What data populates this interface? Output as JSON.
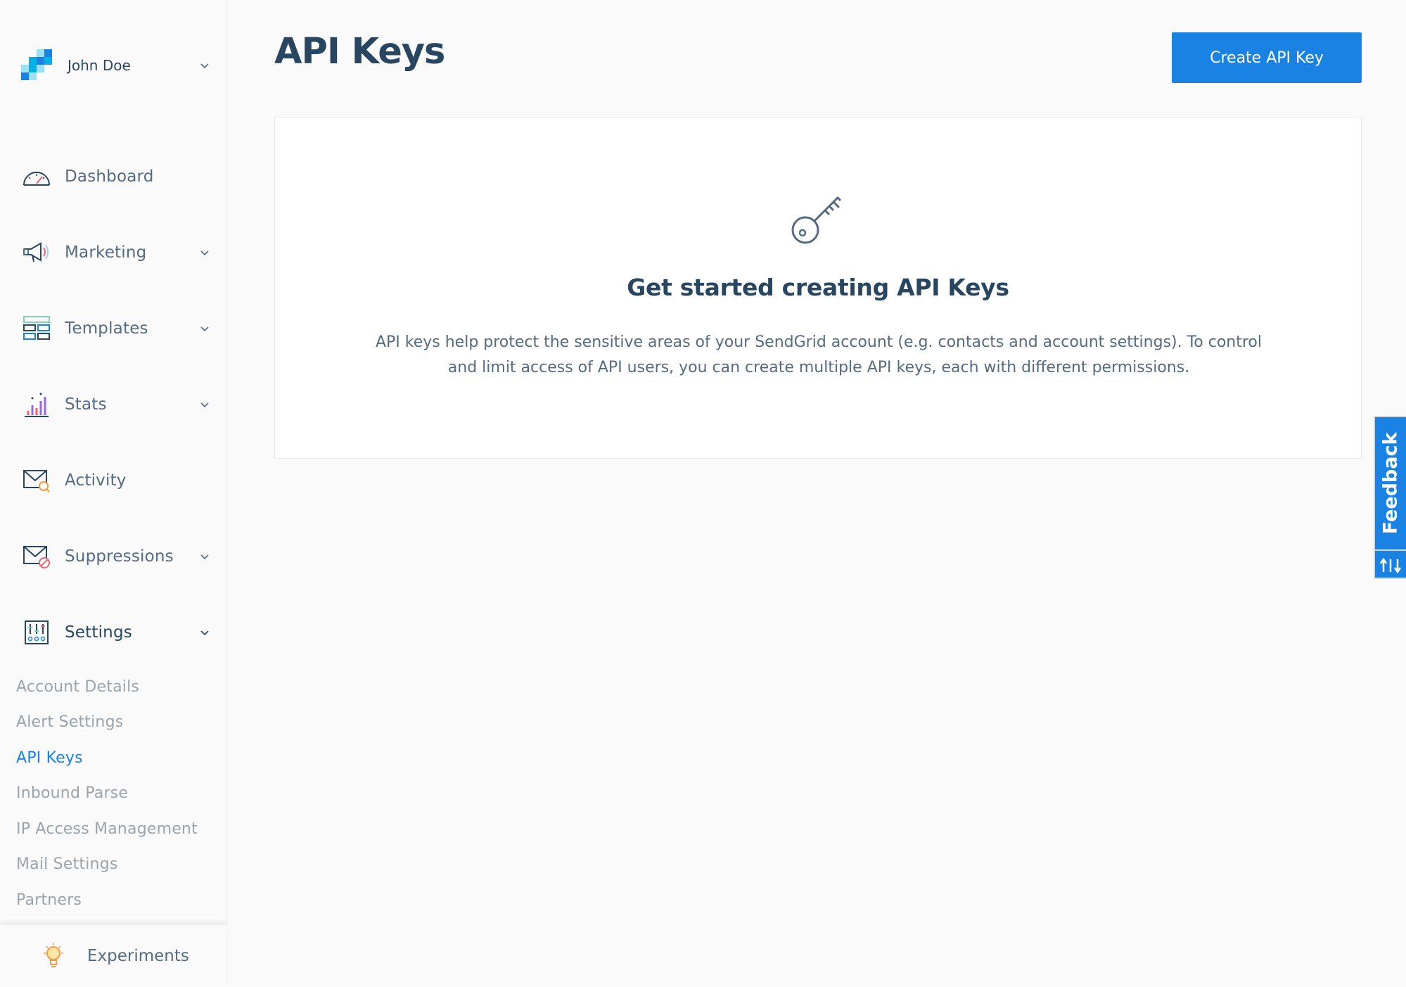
{
  "account": {
    "name": "John Doe",
    "logo": "sendgrid-logo",
    "brand_colors": [
      "#1a82e2",
      "#00b2e3",
      "#99e1f4"
    ]
  },
  "nav": [
    {
      "label": "Dashboard",
      "icon": "dashboard-gauge-icon"
    },
    {
      "label": "Marketing",
      "icon": "megaphone-icon",
      "expandable": true
    },
    {
      "label": "Templates",
      "icon": "templates-icon",
      "expandable": true
    },
    {
      "label": "Stats",
      "icon": "stats-bar-icon",
      "expandable": true
    },
    {
      "label": "Activity",
      "icon": "activity-mail-search-icon"
    },
    {
      "label": "Suppressions",
      "icon": "suppressions-mail-block-icon",
      "expandable": true
    },
    {
      "label": "Settings",
      "icon": "settings-sliders-icon",
      "expandable": true,
      "expanded": true
    }
  ],
  "settings_subnav": [
    {
      "label": "Account Details"
    },
    {
      "label": "Alert Settings"
    },
    {
      "label": "API Keys",
      "active": true
    },
    {
      "label": "Inbound Parse"
    },
    {
      "label": "IP Access Management"
    },
    {
      "label": "Mail Settings"
    },
    {
      "label": "Partners"
    }
  ],
  "experiments": {
    "label": "Experiments",
    "icon": "lightbulb-icon"
  },
  "page": {
    "title": "API Keys",
    "create_button": "Create API Key"
  },
  "empty_state": {
    "icon": "key-icon",
    "title": "Get started creating API Keys",
    "description": "API keys help protect the sensitive areas of your SendGrid account (e.g. contacts and account settings). To control and limit access of API users, you can create multiple API keys, each with different permissions."
  },
  "feedback": {
    "label": "Feedback",
    "icon": "updown-arrows-icon"
  },
  "colors": {
    "accent": "#1a82e2",
    "heading": "#294661",
    "body_text": "#546b81",
    "muted_text": "#9aa4ad"
  }
}
